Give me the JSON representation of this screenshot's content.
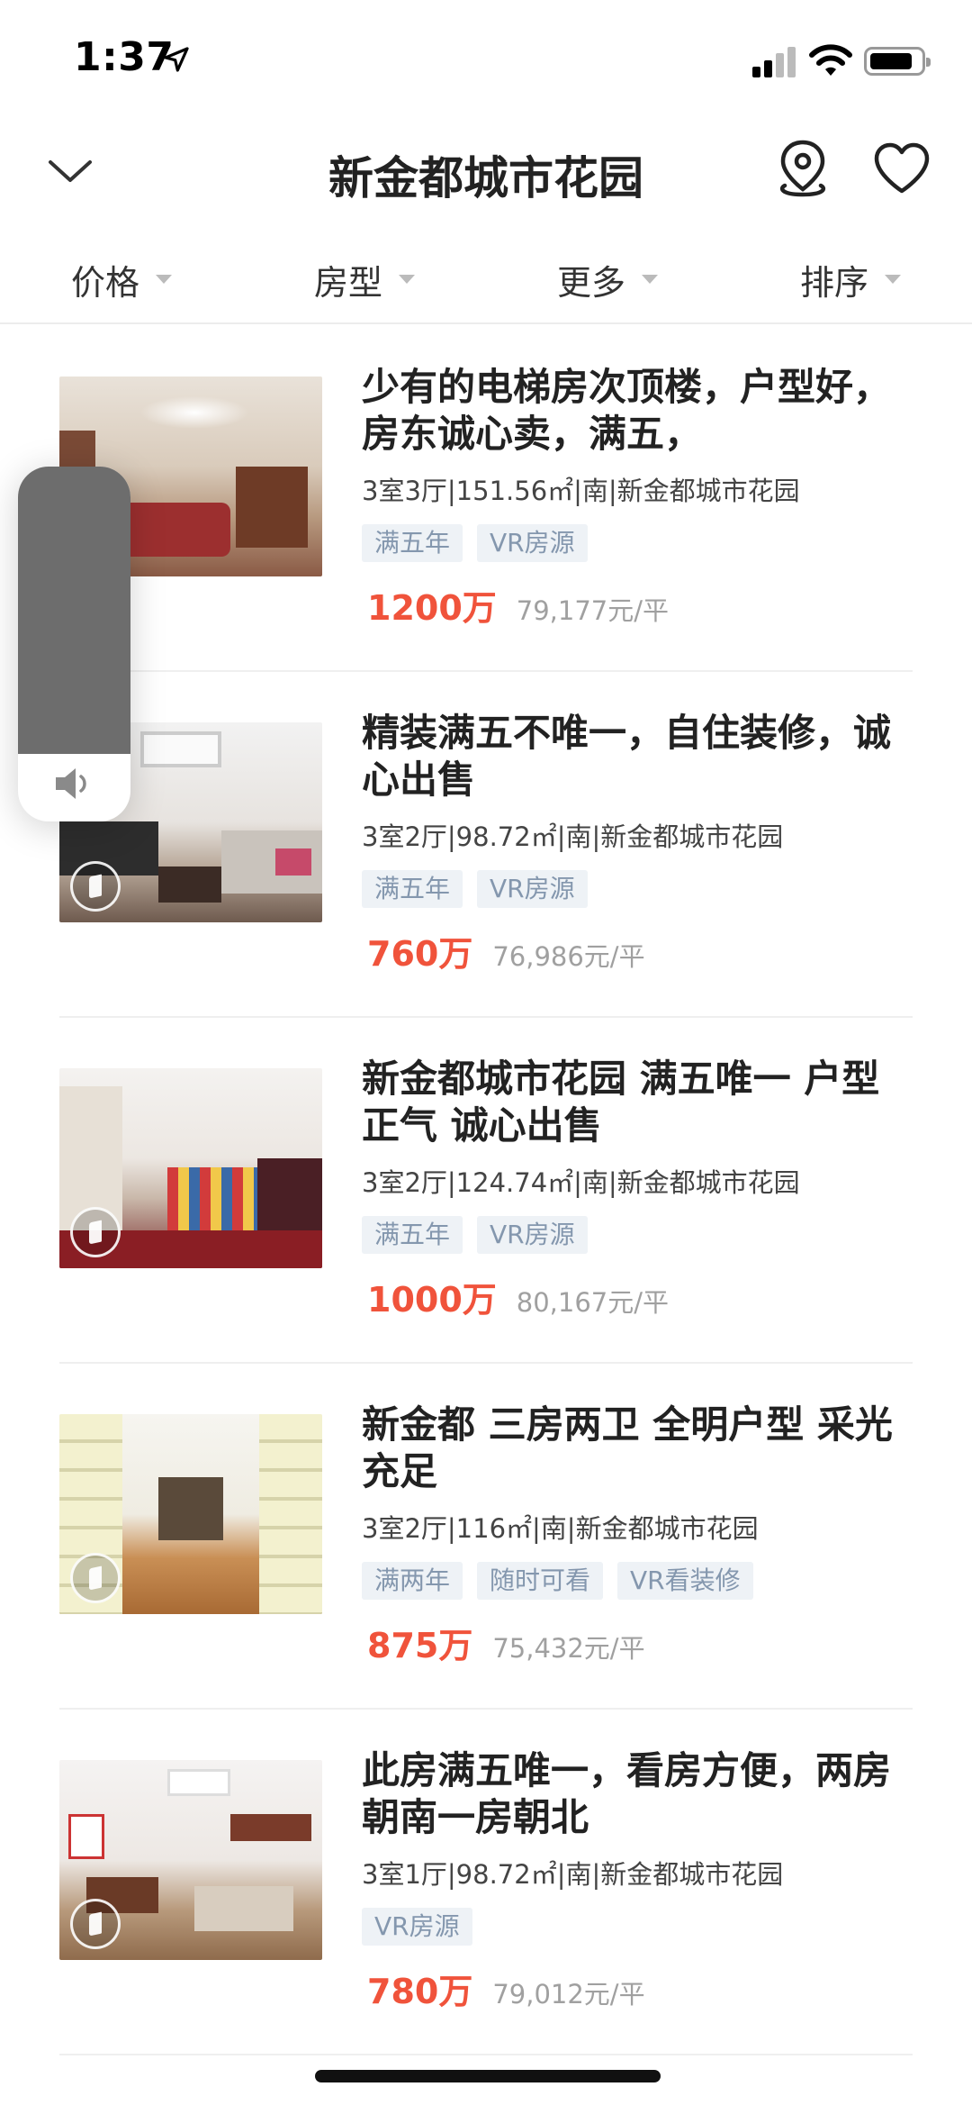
{
  "status_bar": {
    "time": "1:37"
  },
  "nav": {
    "title": "新金都城市花园"
  },
  "filters": [
    {
      "label": "价格"
    },
    {
      "label": "房型"
    },
    {
      "label": "更多"
    },
    {
      "label": "排序"
    }
  ],
  "listings": [
    {
      "title": "少有的电梯房次顶楼，户型好，房东诚心卖，满五，",
      "meta": "3室3厅|151.56㎡|南|新金都城市花园",
      "tags": [
        "满五年",
        "VR房源"
      ],
      "price_total": "1200万",
      "price_unit": "79,177元/平"
    },
    {
      "title": "精装满五不唯一，自住装修，诚心出售",
      "meta": "3室2厅|98.72㎡|南|新金都城市花园",
      "tags": [
        "满五年",
        "VR房源"
      ],
      "price_total": "760万",
      "price_unit": "76,986元/平"
    },
    {
      "title": "新金都城市花园 满五唯一 户型正气 诚心出售",
      "meta": "3室2厅|124.74㎡|南|新金都城市花园",
      "tags": [
        "满五年",
        "VR房源"
      ],
      "price_total": "1000万",
      "price_unit": "80,167元/平"
    },
    {
      "title": "新金都 三房两卫 全明户型 采光充足",
      "meta": "3室2厅|116㎡|南|新金都城市花园",
      "tags": [
        "满两年",
        "随时可看",
        "VR看装修"
      ],
      "price_total": "875万",
      "price_unit": "75,432元/平"
    },
    {
      "title": "此房满五唯一，看房方便，两房朝南一房朝北",
      "meta": "3室1厅|98.72㎡|南|新金都城市花园",
      "tags": [
        "VR房源"
      ],
      "price_total": "780万",
      "price_unit": "79,012元/平"
    }
  ],
  "volume_hud": {
    "level": 0.81,
    "icon": "speaker-icon"
  },
  "colors": {
    "price": "#f0533b",
    "tag_bg": "#eef2f6",
    "tag_text": "#8497ae"
  }
}
